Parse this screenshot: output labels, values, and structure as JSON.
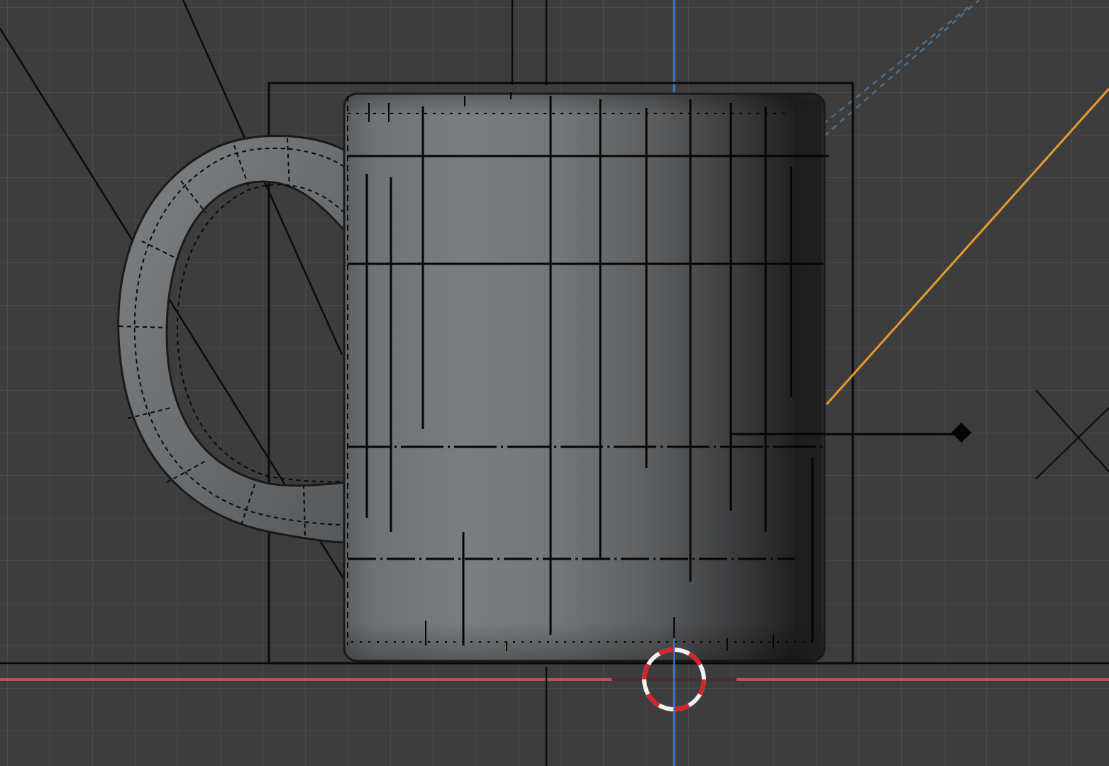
{
  "viewport": {
    "type": "3d-viewport",
    "object": "mug",
    "shading": "solid",
    "overlays": {
      "grid": true,
      "wireframe": true,
      "bounding_box": true
    },
    "colors": {
      "background": "#3d3d3d",
      "grid_line": "#4a4a4a",
      "x_axis": "#b5525e",
      "z_axis": "#3f79c8",
      "mesh_base": "#777a7c",
      "mesh_shadow": "#1e1e1e",
      "wire": "#050505",
      "camera_frustum": "#e89a2b",
      "cursor_red": "#d8232a",
      "cursor_white": "#f2f2f2"
    },
    "icons": [
      "3d-cursor-icon",
      "light-empty-icon",
      "light-handle-icon"
    ]
  }
}
